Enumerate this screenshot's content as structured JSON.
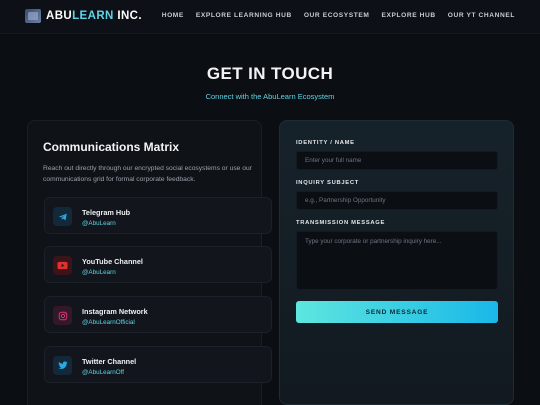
{
  "nav": {
    "brand_prefix": "ABU",
    "brand_highlight": "LEARN",
    "brand_suffix": " INC.",
    "links": [
      "HOME",
      "EXPLORE LEARNING HUB",
      "OUR ECOSYSTEM",
      "EXPLORE HUB",
      "OUR YT CHANNEL"
    ]
  },
  "hero": {
    "title": "GET IN TOUCH",
    "subtitle": "Connect with the AbuLearn Ecosystem"
  },
  "communications": {
    "title": "Communications Matrix",
    "description": "Reach out directly through our encrypted social ecosystems or use our communications grid for formal corporate feedback.",
    "channels": [
      {
        "name": "Telegram Hub",
        "handle": "@AbuLearn",
        "icon": "telegram-icon",
        "color": "#2aa8e0"
      },
      {
        "name": "YouTube Channel",
        "handle": "@AbuLearn",
        "icon": "youtube-icon",
        "color": "#e0302f"
      },
      {
        "name": "Instagram Network",
        "handle": "@AbuLearnOfficial",
        "icon": "instagram-icon",
        "color": "#d8366f"
      },
      {
        "name": "Twitter Channel",
        "handle": "@AbuLearnOff",
        "icon": "twitter-icon",
        "color": "#2aa8e0"
      }
    ]
  },
  "form": {
    "identity_label": "IDENTITY / NAME",
    "identity_placeholder": "Enter your full name",
    "subject_label": "INQUIRY SUBJECT",
    "subject_placeholder": "e.g., Partnership Opportunity",
    "message_label": "TRANSMISSION MESSAGE",
    "message_placeholder": "Type your corporate or partnership inquiry here...",
    "send_label": "SEND MESSAGE"
  },
  "colors": {
    "accent": "#5fd4e6",
    "background": "#0b0e13",
    "button_gradient_start": "#5ee6df",
    "button_gradient_end": "#19b8e8"
  }
}
